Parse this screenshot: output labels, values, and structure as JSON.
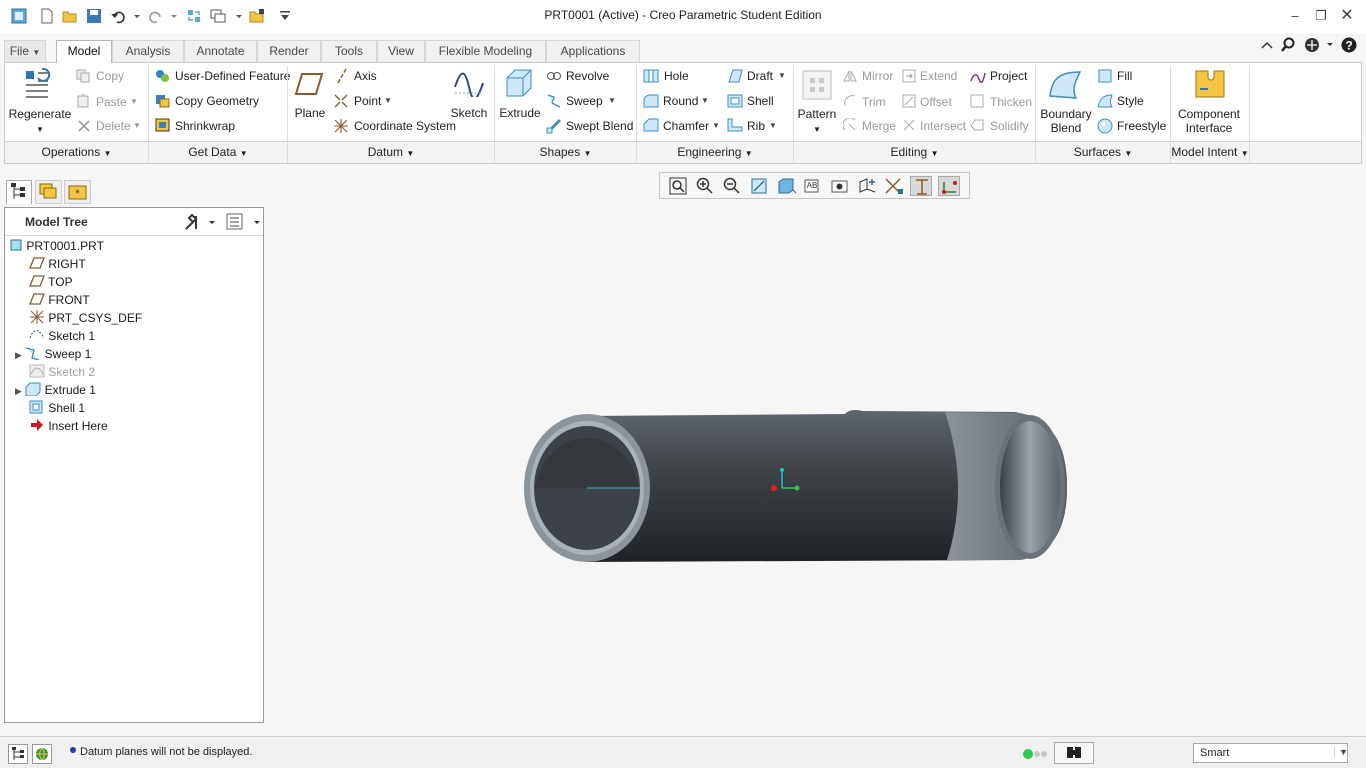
{
  "window": {
    "title": "PRT0001 (Active) - Creo Parametric Student Edition"
  },
  "tabs": [
    "File",
    "Model",
    "Analysis",
    "Annotate",
    "Render",
    "Tools",
    "View",
    "Flexible Modeling",
    "Applications"
  ],
  "ribbon": {
    "operations": {
      "regenerate": "Regenerate",
      "copy": "Copy",
      "paste": "Paste",
      "delete": "Delete",
      "group": "Operations"
    },
    "get_data": {
      "udf": "User-Defined Feature",
      "copy_geometry": "Copy Geometry",
      "shrinkwrap": "Shrinkwrap",
      "group": "Get Data"
    },
    "datum": {
      "plane": "Plane",
      "axis": "Axis",
      "point": "Point",
      "csys": "Coordinate System",
      "sketch": "Sketch",
      "group": "Datum"
    },
    "shapes": {
      "extrude": "Extrude",
      "revolve": "Revolve",
      "sweep": "Sweep",
      "swept_blend": "Swept Blend",
      "group": "Shapes"
    },
    "engineering": {
      "hole": "Hole",
      "round": "Round",
      "chamfer": "Chamfer",
      "draft": "Draft",
      "shell": "Shell",
      "rib": "Rib",
      "group": "Engineering"
    },
    "editing": {
      "pattern": "Pattern",
      "mirror": "Mirror",
      "trim": "Trim",
      "merge": "Merge",
      "extend": "Extend",
      "offset": "Offset",
      "intersect": "Intersect",
      "project": "Project",
      "thicken": "Thicken",
      "solidify": "Solidify",
      "group": "Editing"
    },
    "surfaces": {
      "boundary_blend_1": "Boundary",
      "boundary_blend_2": "Blend",
      "fill": "Fill",
      "style": "Style",
      "freestyle": "Freestyle",
      "group": "Surfaces"
    },
    "model_intent": {
      "component_interface_1": "Component",
      "component_interface_2": "Interface",
      "group": "Model Intent"
    }
  },
  "model_tree": {
    "header": "Model Tree",
    "items": [
      {
        "label": "PRT0001.PRT",
        "icon": "part-icon"
      },
      {
        "label": "RIGHT",
        "icon": "datum-plane-icon"
      },
      {
        "label": "TOP",
        "icon": "datum-plane-icon"
      },
      {
        "label": "FRONT",
        "icon": "datum-plane-icon"
      },
      {
        "label": "PRT_CSYS_DEF",
        "icon": "csys-icon"
      },
      {
        "label": "Sketch 1",
        "icon": "sketch-icon"
      },
      {
        "label": "Sweep 1",
        "icon": "sweep-icon"
      },
      {
        "label": "Sketch 2",
        "icon": "sketch-icon"
      },
      {
        "label": "Extrude 1",
        "icon": "extrude-icon"
      },
      {
        "label": "Shell 1",
        "icon": "shell-icon"
      },
      {
        "label": "Insert Here",
        "icon": "insert-arrow-icon"
      }
    ]
  },
  "status": {
    "message": "Datum planes will not be displayed.",
    "filter": "Smart"
  },
  "colors": {
    "accent": "#1a6fc0",
    "tube_dark": "#3a3f44",
    "tube_light": "#9aa2aa"
  }
}
